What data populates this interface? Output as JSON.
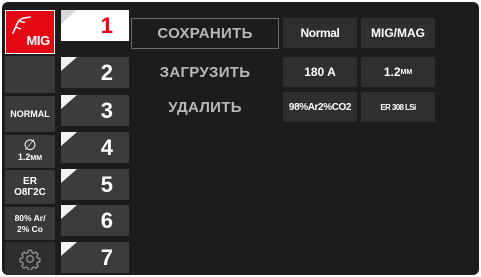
{
  "colors": {
    "accent": "#e30613",
    "screen": "#1c1c1c",
    "tile": "#2f2f2f"
  },
  "status": {
    "mode_badge": "MIG",
    "normal": "NORMAL",
    "wire_symbol": "∅",
    "wire_value": "1.2",
    "wire_unit": "MM",
    "alloy_line1": "ER",
    "alloy_line2": "O8Г2С",
    "gas_line1": "80% Ar/",
    "gas_line2": "2% Co",
    "settings_icon": "gear-icon"
  },
  "slots": [
    "1",
    "2",
    "3",
    "4",
    "5",
    "6",
    "7"
  ],
  "active_slot": "1",
  "actions": {
    "save": "СОХРАНИТЬ",
    "load": "ЗАГРУЗИТЬ",
    "delete": "УДАЛИТЬ"
  },
  "info": {
    "mode": "Normal",
    "process": "MIG/MAG",
    "current": "180 A",
    "wire_value": "1.2",
    "wire_unit": "MM",
    "gas": "98%Ar2%CO2",
    "alloy": "ER 308 LSi"
  }
}
